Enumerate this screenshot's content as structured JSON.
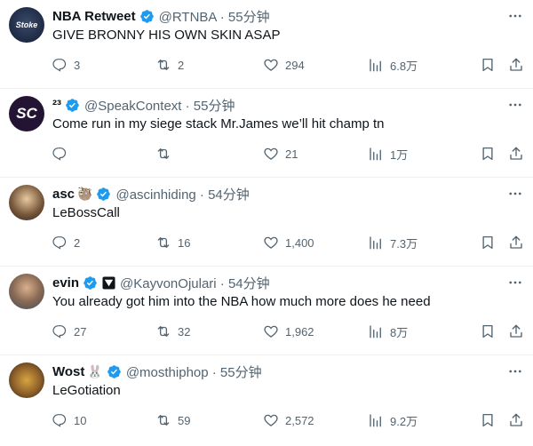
{
  "tweets": [
    {
      "name": "NBA Retweet",
      "name_emoji": "",
      "verified": true,
      "extra_badge": false,
      "handle_time": "@RTNBA · 55分钟",
      "text": "GIVE BRONNY HIS OWN SKIN ASAP",
      "avatar_text": "Stoke",
      "replies": "3",
      "retweets": "2",
      "likes": "294",
      "views": "6.8万"
    },
    {
      "name": "²³",
      "name_emoji": "",
      "verified": true,
      "extra_badge": false,
      "handle_time": "@SpeakContext · 55分钟",
      "text": "Come run in my siege stack Mr.James we’ll hit champ tn",
      "avatar_text": "SC",
      "replies": "",
      "retweets": "",
      "likes": "21",
      "views": "1万"
    },
    {
      "name": "asc",
      "name_emoji": "🦥",
      "verified": true,
      "extra_badge": false,
      "handle_time": "@ascinhiding · 54分钟",
      "text": "LeBossCall",
      "avatar_text": "",
      "replies": "2",
      "retweets": "16",
      "likes": "1,400",
      "views": "7.3万"
    },
    {
      "name": "evin",
      "name_emoji": "",
      "verified": true,
      "extra_badge": true,
      "handle_time": "@KayvonOjulari · 54分钟",
      "text": "You already got him into the NBA how much more does he need",
      "avatar_text": "",
      "replies": "27",
      "retweets": "32",
      "likes": "1,962",
      "views": "8万"
    },
    {
      "name": "Wost",
      "name_emoji": "🐰",
      "verified": true,
      "extra_badge": false,
      "handle_time": "@mosthiphop · 55分钟",
      "text": "LeGotiation",
      "avatar_text": "",
      "replies": "10",
      "retweets": "59",
      "likes": "2,572",
      "views": "9.2万"
    }
  ],
  "icons": {
    "reply": "reply-icon",
    "retweet": "retweet-icon",
    "like": "heart-icon",
    "views": "views-icon",
    "bookmark": "bookmark-icon",
    "share": "share-icon",
    "more": "more-icon",
    "verified": "verified-badge-icon"
  },
  "colors": {
    "verified": "#1d9bf0",
    "secondary": "#536471"
  }
}
